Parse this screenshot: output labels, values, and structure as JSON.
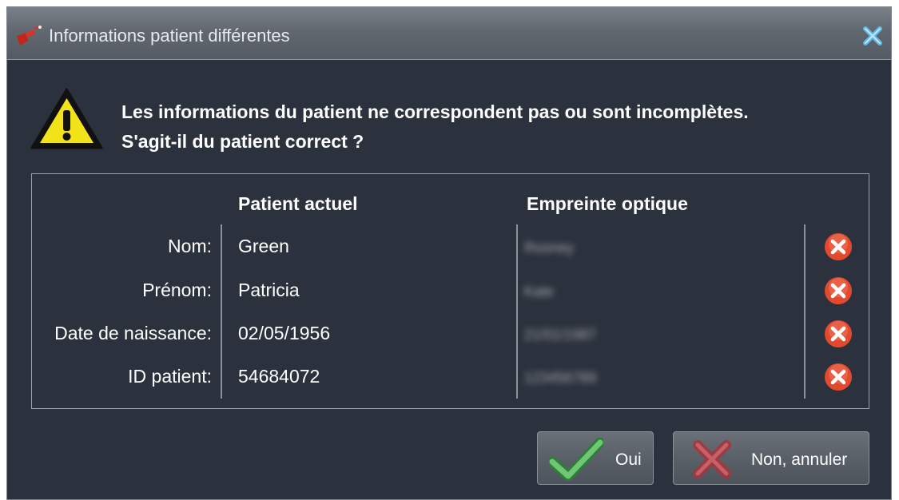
{
  "dialog": {
    "title": "Informations patient différentes",
    "message_line1": "Les informations du patient ne correspondent pas ou sont incomplètes.",
    "message_line2": "S'agit-il du patient correct ?"
  },
  "table": {
    "col_current": "Patient actuel",
    "col_impression": "Empreinte optique",
    "rows": [
      {
        "label": "Nom:",
        "current": "Green",
        "impression": "Rooney",
        "match": false
      },
      {
        "label": "Prénom:",
        "current": "Patricia",
        "impression": "Kate",
        "match": false
      },
      {
        "label": "Date de naissance:",
        "current": "02/05/1956",
        "impression": "21/01/1987",
        "match": false
      },
      {
        "label": "ID patient:",
        "current": "54684072",
        "impression": "123456789",
        "match": false
      }
    ]
  },
  "buttons": {
    "yes_label": "Oui",
    "no_label": "Non, annuler"
  },
  "colors": {
    "background": "#2c323d",
    "warning_yellow": "#f2e21a",
    "mismatch_red": "#e24a2e",
    "check_green": "#4fae55"
  },
  "icons": {
    "app": "scanner-app-icon",
    "close": "close-icon",
    "warning": "warning-triangle-icon",
    "mismatch": "red-x-circle-icon",
    "yes": "green-check-icon",
    "no": "red-cross-icon"
  }
}
